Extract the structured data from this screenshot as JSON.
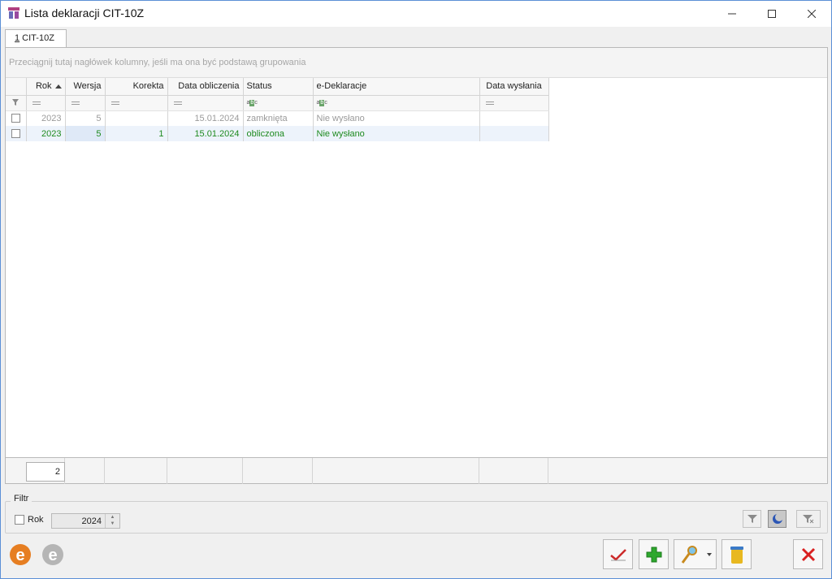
{
  "window": {
    "title": "Lista deklaracji CIT-10Z"
  },
  "tabs": [
    {
      "accel": "1",
      "label": " CIT-10Z"
    }
  ],
  "grid": {
    "group_hint": "Przeciągnij tutaj nagłówek kolumny, jeśli ma ona być podstawą grupowania",
    "columns": [
      "Rok",
      "Wersja",
      "Korekta",
      "Data obliczenia",
      "Status",
      "e-Deklaracje",
      "Data wysłania"
    ],
    "sort_column": "Rok",
    "rows": [
      {
        "rok": "2023",
        "wersja": "5",
        "korekta": "",
        "data_obliczenia": "15.01.2024",
        "status": "zamknięta",
        "edeklaracje": "Nie wysłano",
        "data_wyslania": ""
      },
      {
        "rok": "2023",
        "wersja": "5",
        "korekta": "1",
        "data_obliczenia": "15.01.2024",
        "status": "obliczona",
        "edeklaracje": "Nie wysłano",
        "data_wyslania": ""
      }
    ],
    "row_count": "2"
  },
  "filter": {
    "legend": "Filtr",
    "rok_label": "Rok",
    "rok_value": "2024"
  },
  "colors": {
    "grey_row": "#9b9b9b",
    "green_row": "#1e8a1e",
    "accent": "#5b8fd6"
  }
}
